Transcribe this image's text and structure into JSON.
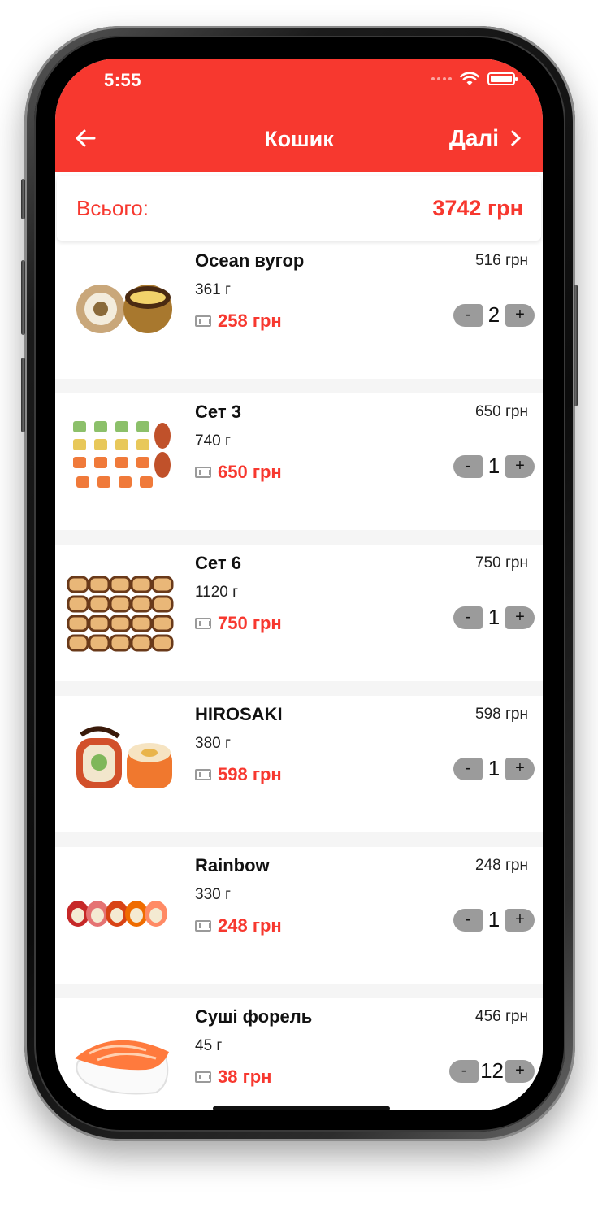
{
  "status_bar": {
    "time": "5:55"
  },
  "nav": {
    "title": "Кошик",
    "next_label": "Далі",
    "back_icon": "arrow-left-icon"
  },
  "summary": {
    "total_label": "Всього:",
    "total_value": "3742 грн"
  },
  "cart": [
    {
      "name": "Ocean вугор",
      "weight": "361 г",
      "unit_price": "258 грн",
      "line_total": "516 грн",
      "qty": "2"
    },
    {
      "name": "Сет 3",
      "weight": "740 г",
      "unit_price": "650 грн",
      "line_total": "650 грн",
      "qty": "1"
    },
    {
      "name": "Сет 6",
      "weight": "1120 г",
      "unit_price": "750 грн",
      "line_total": "750 грн",
      "qty": "1"
    },
    {
      "name": "HIROSAKI",
      "weight": "380 г",
      "unit_price": "598 грн",
      "line_total": "598 грн",
      "qty": "1"
    },
    {
      "name": "Rainbow",
      "weight": "330 г",
      "unit_price": "248 грн",
      "line_total": "248 грн",
      "qty": "1"
    },
    {
      "name": "Суші форель",
      "weight": "45 г",
      "unit_price": "38 грн",
      "line_total": "456 грн",
      "qty": "12"
    }
  ],
  "stepper": {
    "minus": "-",
    "plus": "+"
  },
  "colors": {
    "accent": "#f7382f",
    "stepper": "#9b9b9b",
    "separator": "#f5f5f5"
  }
}
